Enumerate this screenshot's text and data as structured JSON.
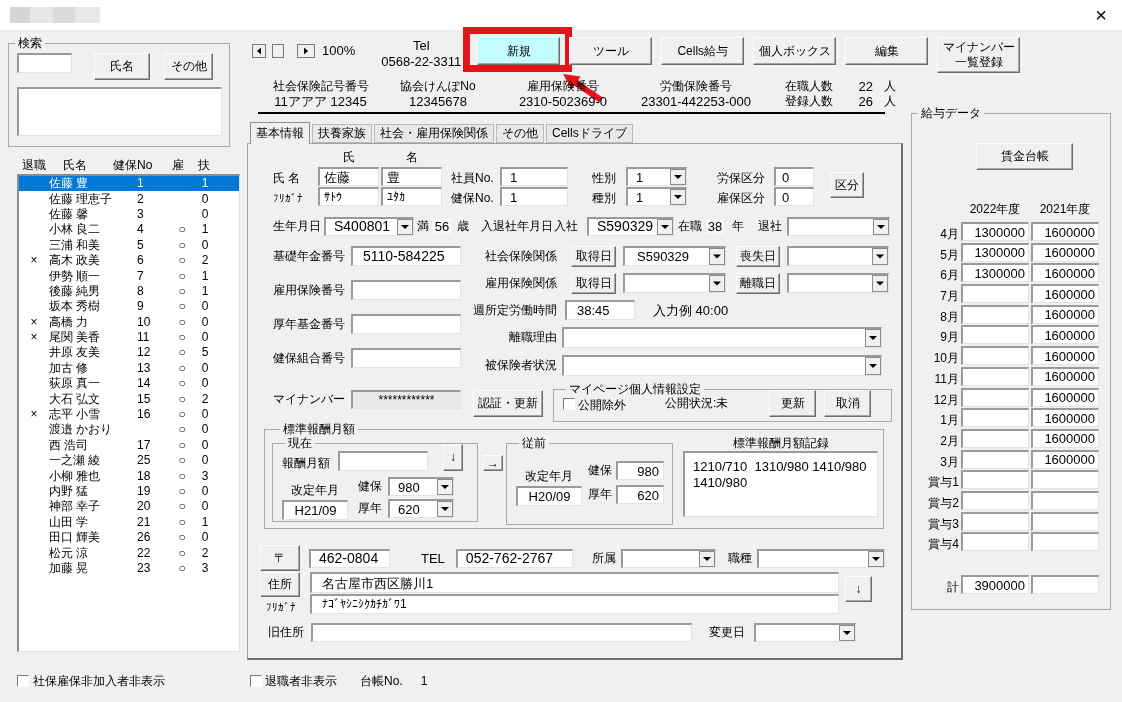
{
  "window": {
    "close": "×"
  },
  "search": {
    "title": "検索",
    "buttons": [
      "氏名",
      "その他"
    ]
  },
  "employee_list": {
    "columns": [
      "退職",
      "氏名",
      "健保No",
      "雇",
      "扶"
    ],
    "rows": [
      {
        "name": "佐藤 豊",
        "health_no": "1",
        "dependents": "1",
        "selected": true
      },
      {
        "name": "佐藤 理恵子",
        "health_no": "2",
        "dependents": "0",
        "selected": false
      },
      {
        "name": "佐藤 馨",
        "health_no": "3",
        "dependents": "0",
        "selected": false
      },
      {
        "name": "小林 良二",
        "health_no": "4",
        "employment": "○",
        "dependents": "1",
        "selected": false
      },
      {
        "name": "三浦 和美",
        "health_no": "5",
        "employment": "○",
        "dependents": "0",
        "selected": false
      },
      {
        "retired": "×",
        "name": "高木 政美",
        "health_no": "6",
        "employment": "○",
        "dependents": "2",
        "selected": false
      },
      {
        "name": "伊勢 順一",
        "health_no": "7",
        "employment": "○",
        "dependents": "1",
        "selected": false
      },
      {
        "name": "後藤 純男",
        "health_no": "8",
        "employment": "○",
        "dependents": "1",
        "selected": false
      },
      {
        "name": "坂本 秀樹",
        "health_no": "9",
        "employment": "○",
        "dependents": "0",
        "selected": false
      },
      {
        "retired": "×",
        "name": "高橋 力",
        "health_no": "10",
        "employment": "○",
        "dependents": "0",
        "selected": false
      },
      {
        "retired": "×",
        "name": "尾関 美香",
        "health_no": "11",
        "employment": "○",
        "dependents": "0",
        "selected": false
      },
      {
        "name": "井原 友美",
        "health_no": "12",
        "employment": "○",
        "dependents": "5",
        "selected": false
      },
      {
        "name": "加古 修",
        "health_no": "13",
        "employment": "○",
        "dependents": "0",
        "selected": false
      },
      {
        "name": "荻原 真一",
        "health_no": "14",
        "employment": "○",
        "dependents": "0",
        "selected": false
      },
      {
        "name": "大石 弘文",
        "health_no": "15",
        "employment": "○",
        "dependents": "2",
        "selected": false
      },
      {
        "retired": "×",
        "name": "志平 小雪",
        "health_no": "16",
        "employment": "○",
        "dependents": "0",
        "selected": false
      },
      {
        "name": "渡邉 かおり",
        "employment": "○",
        "dependents": "0",
        "selected": false
      },
      {
        "name": "西 浩司",
        "health_no": "17",
        "employment": "○",
        "dependents": "0",
        "selected": false
      },
      {
        "name": "一之瀬 綾",
        "health_no": "25",
        "employment": "○",
        "dependents": "0",
        "selected": false
      },
      {
        "name": "小柳 雅也",
        "health_no": "18",
        "employment": "○",
        "dependents": "3",
        "selected": false
      },
      {
        "name": "内野 猛",
        "health_no": "19",
        "employment": "○",
        "dependents": "0",
        "selected": false
      },
      {
        "name": "神部 幸子",
        "health_no": "20",
        "employment": "○",
        "dependents": "0",
        "selected": false
      },
      {
        "name": "山田 学",
        "health_no": "21",
        "employment": "○",
        "dependents": "1",
        "selected": false
      },
      {
        "name": "田口 輝美",
        "health_no": "26",
        "employment": "○",
        "dependents": "0",
        "selected": false
      },
      {
        "name": "松元 涼",
        "health_no": "22",
        "employment": "○",
        "dependents": "2",
        "selected": false
      },
      {
        "name": "加藤 晃",
        "health_no": "23",
        "employment": "○",
        "dependents": "3",
        "selected": false
      }
    ]
  },
  "hide_uninsured": {
    "label": "社保雇保非加入者非表示",
    "checked": false
  },
  "toolbar": {
    "zoom": "100%",
    "tel_label": "Tel",
    "tel": "0568-22-3311",
    "buttons": [
      {
        "label": "新規",
        "highlighted": true,
        "annotated": true
      },
      {
        "label": "ツール",
        "highlighted": false,
        "annotated": false
      },
      {
        "label": "Cells給与",
        "highlighted": false,
        "annotated": false
      },
      {
        "label": "個人ボックス",
        "highlighted": false,
        "annotated": false
      },
      {
        "label": "編集",
        "highlighted": false,
        "annotated": false
      },
      {
        "label": "マイナンバー一覧登録",
        "highlighted": false,
        "annotated": false
      }
    ]
  },
  "company_info": [
    {
      "label": "社会保険記号番号",
      "value": "11アアア 12345"
    },
    {
      "label": "協会けんぽNo",
      "value": "12345678"
    },
    {
      "label": "雇用保険番号",
      "value": "2310-502369-0"
    },
    {
      "label": "労働保険番号",
      "value": "23301-442253-000"
    }
  ],
  "headcount": [
    {
      "label": "在職人数",
      "value": "22",
      "unit": "人"
    },
    {
      "label": "登録人数",
      "value": "26",
      "unit": "人"
    }
  ],
  "tabs": [
    {
      "label": "基本情報",
      "selected": true
    },
    {
      "label": "扶養家族",
      "selected": false
    },
    {
      "label": "社会・雇用保険関係",
      "selected": false
    },
    {
      "label": "その他",
      "selected": false
    },
    {
      "label": "Cellsドライブ",
      "selected": false
    }
  ],
  "name": {
    "family_header": "氏",
    "given_header": "名",
    "name_label": "氏 名",
    "kana_label": "ﾌﾘｶﾞﾅ",
    "family": "佐藤",
    "given": "豊",
    "family_kana": "ｻﾄｳ",
    "given_kana": "ﾕﾀｶ"
  },
  "numbers": [
    {
      "label": "社員No.",
      "value": "1"
    },
    {
      "label": "健保No.",
      "value": "1"
    }
  ],
  "categories": [
    {
      "label": "性別",
      "value": "1"
    },
    {
      "label": "種別",
      "value": "1"
    }
  ],
  "divisions": [
    {
      "label": "労保区分",
      "value": "0"
    },
    {
      "label": "雇保区分",
      "value": "0"
    }
  ],
  "division_button": "区分",
  "dates": {
    "birth_label": "生年月日",
    "birth": "S400801",
    "age_prefix": "満",
    "age": "56",
    "age_unit": "歳",
    "label": "入退社年月日",
    "entry_label": "入社",
    "entry": "S590329",
    "tenure_label": "在職",
    "tenure": "38",
    "tenure_unit": "年",
    "exit_label": "退社"
  },
  "registry_numbers": [
    {
      "label": "基礎年金番号",
      "value": "5110-584225"
    },
    {
      "label": "雇用保険番号"
    },
    {
      "label": "厚年基金番号"
    },
    {
      "label": "健保組合番号"
    }
  ],
  "insurance": [
    {
      "label": "社会保険関係",
      "acquired_button": "取得日",
      "acquired": "S590329",
      "lost_button": "喪失日"
    },
    {
      "label": "雇用保険関係",
      "acquired_button": "取得日",
      "lost_button": "離職日"
    }
  ],
  "weekly_hours": {
    "label": "週所定労働時間",
    "value": "38:45",
    "example": "入力例 40:00"
  },
  "separation_reason": {
    "label": "離職理由"
  },
  "insured_status": {
    "label": "被保険者状況"
  },
  "my_number": {
    "label": "マイナンバー",
    "value": "************",
    "button": "認証・更新"
  },
  "my_page": {
    "title": "マイページ個人情報設定",
    "exclude": {
      "label": "公開除外",
      "checked": false
    },
    "status": "公開状況:未",
    "buttons": [
      "更新",
      "取消"
    ]
  },
  "standard_pay": {
    "title": "標準報酬月額",
    "current": {
      "title": "現在",
      "pay_label": "報酬月額",
      "down_button": "↓",
      "revised_label": "改定年月",
      "revised": "H21/09",
      "health_label": "健保",
      "health": "980",
      "pension_label": "厚年",
      "pension": "620"
    },
    "move_button": "→",
    "previous": {
      "title": "従前",
      "revised_label": "改定年月",
      "revised": "H20/09",
      "health_label": "健保",
      "health": "980",
      "pension_label": "厚年",
      "pension": "620"
    },
    "history": {
      "title": "標準報酬月額記録",
      "lines": [
        "1210/710  1310/980 1410/980",
        "1410/980"
      ]
    }
  },
  "contact": {
    "zip_button": "〒",
    "zip": "462-0804",
    "tel_label": "TEL",
    "tel": "052-762-2767",
    "dept_label": "所属",
    "job_label": "職種",
    "address_button": "住所",
    "kana_label": "ﾌﾘｶﾞﾅ",
    "address": "名古屋市西区勝川1",
    "address_kana": "ﾅｺﾞﾔｼﾆｼｸｶﾁｶﾞﾜ1",
    "down_button": "↓",
    "old_address_label": "旧住所",
    "changed_label": "変更日"
  },
  "footer": {
    "hide_retired": {
      "label": "退職者非表示",
      "checked": false
    },
    "ledger_label": "台帳No.",
    "ledger": "1"
  },
  "pay_data": {
    "title": "給与データ",
    "button": "賃金台帳",
    "columns": {
      "current_year": "2022年度",
      "previous_year": "2021年度"
    },
    "rows": [
      {
        "label": "4月",
        "current_year": "1300000",
        "previous_year": "1600000"
      },
      {
        "label": "5月",
        "current_year": "1300000",
        "previous_year": "1600000"
      },
      {
        "label": "6月",
        "current_year": "1300000",
        "previous_year": "1600000"
      },
      {
        "label": "7月",
        "previous_year": "1600000"
      },
      {
        "label": "8月",
        "previous_year": "1600000"
      },
      {
        "label": "9月",
        "previous_year": "1600000"
      },
      {
        "label": "10月",
        "previous_year": "1600000"
      },
      {
        "label": "11月",
        "previous_year": "1600000"
      },
      {
        "label": "12月",
        "previous_year": "1600000"
      },
      {
        "label": "1月",
        "previous_year": "1600000"
      },
      {
        "label": "2月",
        "previous_year": "1600000"
      },
      {
        "label": "3月",
        "previous_year": "1600000"
      },
      {
        "label": "賞与1"
      },
      {
        "label": "賞与2"
      },
      {
        "label": "賞与3"
      },
      {
        "label": "賞与4"
      }
    ],
    "total": {
      "label": "計",
      "current_year": "3900000"
    }
  }
}
